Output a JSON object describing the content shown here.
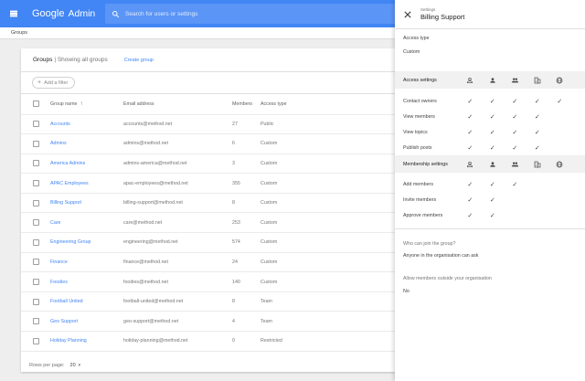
{
  "app": {
    "brand": "Google",
    "product": "Admin",
    "search_placeholder": "Search for users or settings"
  },
  "breadcrumb": "Groups",
  "groups_card": {
    "title": "Groups",
    "subtitle": "| Showing all groups",
    "create_label": "Create group",
    "filter_label": "Add a filter",
    "columns": [
      "Group name",
      "Email address",
      "Members",
      "Access type"
    ],
    "rows": [
      {
        "name": "Accounts",
        "email": "accounts@method.net",
        "members": "27",
        "access": "Public"
      },
      {
        "name": "Admins",
        "email": "admins@method.net",
        "members": "6",
        "access": "Custom"
      },
      {
        "name": "America Admins",
        "email": "admins-america@method.net",
        "members": "3",
        "access": "Custom"
      },
      {
        "name": "APAC Employees",
        "email": "apac-employees@method.net",
        "members": "355",
        "access": "Custom"
      },
      {
        "name": "Billing Support",
        "email": "billing-support@method.net",
        "members": "8",
        "access": "Custom"
      },
      {
        "name": "Care",
        "email": "care@method.net",
        "members": "253",
        "access": "Custom"
      },
      {
        "name": "Engineering Group",
        "email": "engineering@method.net",
        "members": "574",
        "access": "Custom"
      },
      {
        "name": "Finance",
        "email": "finance@method.net",
        "members": "24",
        "access": "Custom"
      },
      {
        "name": "Foodies",
        "email": "foodies@method.net",
        "members": "140",
        "access": "Custom"
      },
      {
        "name": "Football United",
        "email": "football-united@method.net",
        "members": "8",
        "access": "Team"
      },
      {
        "name": "Geo Support",
        "email": "geo-support@method.net",
        "members": "4",
        "access": "Team"
      },
      {
        "name": "Holiday Planning",
        "email": "holiday-planning@method.net",
        "members": "0",
        "access": "Restricted"
      }
    ],
    "pager": {
      "label": "Rows per page:",
      "value": "20"
    }
  },
  "settings_panel": {
    "eyebrow": "Settings",
    "title": "Billing Support",
    "access_type_label": "Access type",
    "access_type_value": "Custom",
    "access_settings": {
      "heading": "Access settings",
      "rows": [
        {
          "label": "Contact owners",
          "checks": [
            true,
            true,
            true,
            true,
            true
          ]
        },
        {
          "label": "View members",
          "checks": [
            true,
            true,
            true,
            true,
            false
          ]
        },
        {
          "label": "View topics",
          "checks": [
            true,
            true,
            true,
            true,
            false
          ]
        },
        {
          "label": "Publish posts",
          "checks": [
            true,
            true,
            true,
            true,
            false
          ]
        }
      ]
    },
    "membership_settings": {
      "heading": "Membership settings",
      "rows": [
        {
          "label": "Add members",
          "checks": [
            true,
            true,
            true,
            false,
            false
          ]
        },
        {
          "label": "Invite members",
          "checks": [
            true,
            true,
            false,
            false,
            false
          ]
        },
        {
          "label": "Approve members",
          "checks": [
            true,
            true,
            false,
            false,
            false
          ]
        }
      ]
    },
    "column_icons": [
      "group-owners-icon",
      "group-managers-icon",
      "group-members-icon",
      "organisation-icon",
      "external-icon"
    ],
    "join_label": "Who can join the group?",
    "join_value": "Anyone in the organisation can ask",
    "outside_label": "Allow members outside your organisation",
    "outside_value": "No"
  },
  "colors": {
    "accent": "#4285f4",
    "link": "#4285f4"
  }
}
